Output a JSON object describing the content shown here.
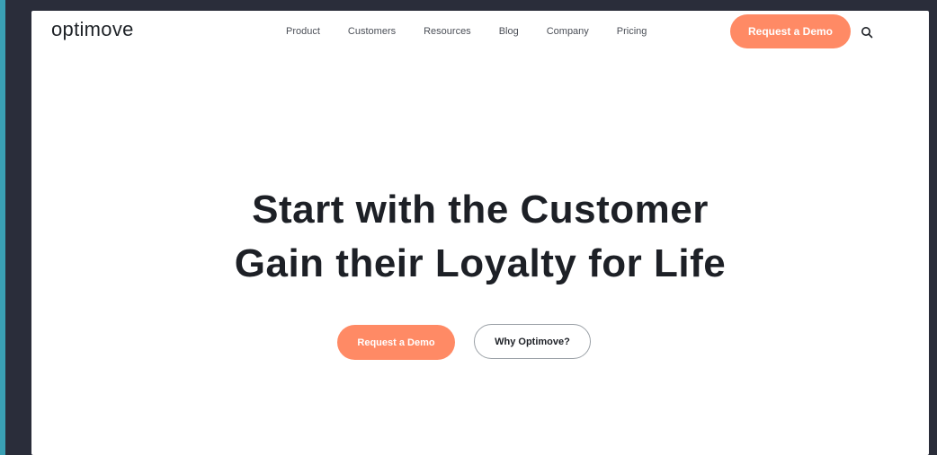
{
  "brand": {
    "logo_text": "optimove"
  },
  "nav": {
    "items": [
      {
        "label": "Product"
      },
      {
        "label": "Customers"
      },
      {
        "label": "Resources"
      },
      {
        "label": "Blog"
      },
      {
        "label": "Company"
      },
      {
        "label": "Pricing"
      }
    ],
    "cta_label": "Request a Demo",
    "search_icon": "search-icon"
  },
  "hero": {
    "title_line_1": "Start with the Customer",
    "title_line_2": "Gain their Loyalty for Life",
    "primary_button": "Request a Demo",
    "secondary_button": "Why Optimove?"
  },
  "colors": {
    "accent": "#ff8a65",
    "text_dark": "#1d2026",
    "background_frame": "#2a2d3a",
    "edge_accent": "#3aa0b4"
  }
}
